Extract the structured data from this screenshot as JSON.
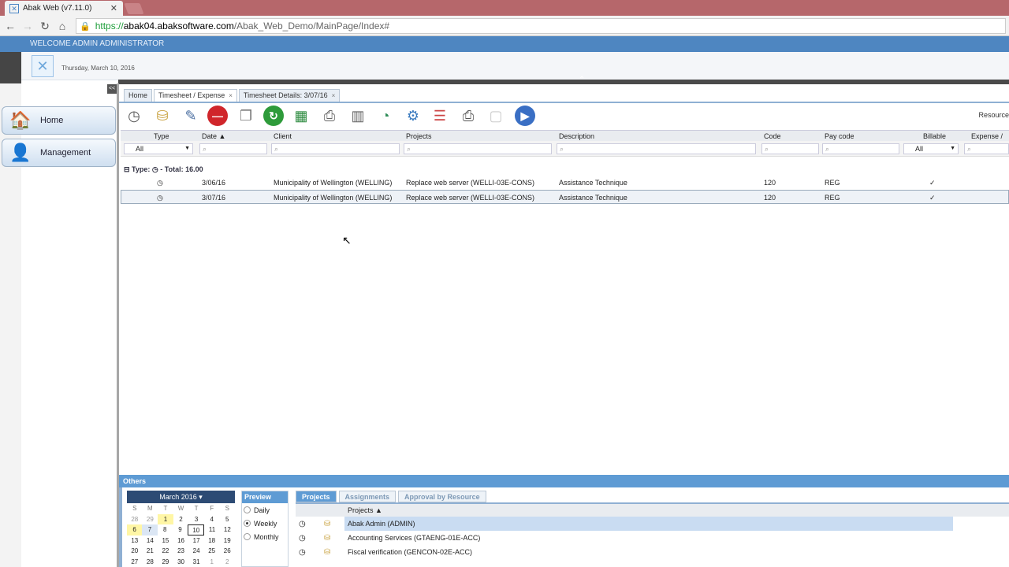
{
  "browser": {
    "tab_title": "Abak Web (v7.11.0)",
    "tab_close": "✕",
    "url_scheme": "https://",
    "url_host": "abak04.abaksoftware.com",
    "url_path": "/Abak_Web_Demo/MainPage/Index#"
  },
  "header": {
    "welcome": "WELCOME ADMIN ADMINISTRATOR",
    "date": "Thursday, March 10, 2016"
  },
  "sidebar": {
    "collapse": "<<",
    "items": [
      {
        "label": "Home"
      },
      {
        "label": "Management"
      }
    ]
  },
  "content_tabs": [
    {
      "label": "Home"
    },
    {
      "label": "Timesheet / Expense",
      "close": "×"
    },
    {
      "label": "Timesheet Details: 3/07/16",
      "close": "×"
    }
  ],
  "toolbar": {
    "resource_label": "Resource"
  },
  "grid": {
    "columns": [
      "Type",
      "Date",
      "Client",
      "Projects",
      "Description",
      "Code",
      "Pay code",
      "Billable",
      "Expense / Q"
    ],
    "type_filter": "All",
    "billable_filter": "All",
    "group_label": "Type:",
    "group_total": "- Total: 16.00",
    "rows": [
      {
        "date": "3/06/16",
        "client": "Municipality of Wellington (WELLING)",
        "project": "Replace web server (WELLI-03E-CONS)",
        "description": "Assistance Technique",
        "code": "120",
        "paycode": "REG",
        "billable": "✓"
      },
      {
        "date": "3/07/16",
        "client": "Municipality of Wellington (WELLING)",
        "project": "Replace web server (WELLI-03E-CONS)",
        "description": "Assistance Technique",
        "code": "120",
        "paycode": "REG",
        "billable": "✓"
      }
    ]
  },
  "others": {
    "title": "Others",
    "calendar": {
      "month": "March 2016 ▾",
      "dow": [
        "S",
        "M",
        "T",
        "W",
        "T",
        "F",
        "S"
      ],
      "weeks": [
        [
          "28",
          "29",
          "1",
          "2",
          "3",
          "4",
          "5"
        ],
        [
          "6",
          "7",
          "8",
          "9",
          "10",
          "11",
          "12"
        ],
        [
          "13",
          "14",
          "15",
          "16",
          "17",
          "18",
          "19"
        ],
        [
          "20",
          "21",
          "22",
          "23",
          "24",
          "25",
          "26"
        ],
        [
          "27",
          "28",
          "29",
          "30",
          "31",
          "1",
          "2"
        ]
      ]
    },
    "preview": {
      "title": "Preview",
      "options": [
        "Daily",
        "Weekly",
        "Monthly"
      ],
      "selected": "Weekly"
    },
    "project_tabs": [
      "Projects",
      "Assignments",
      "Approval by Resource"
    ],
    "project_header": "Projects ▲",
    "projects": [
      "Abak Admin (ADMIN)",
      "Accounting Services (GTAENG-01E-ACC)",
      "Fiscal verification (GENCON-02E-ACC)"
    ]
  }
}
